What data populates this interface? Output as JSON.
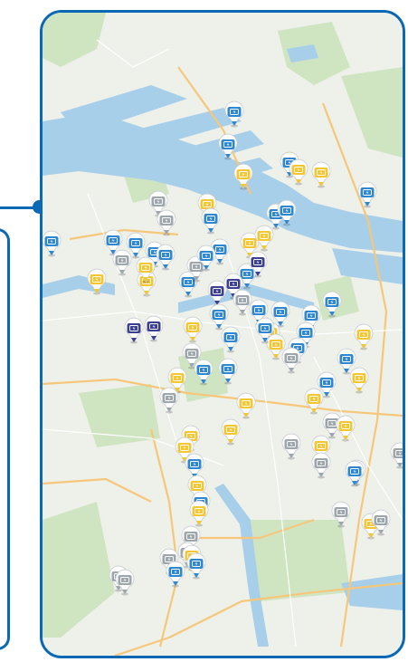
{
  "map": {
    "colors": {
      "frame": "#0a68b4",
      "water": "#a7cfe9",
      "land": "#eef0ea",
      "park": "#cfe5c2",
      "road_major": "#f6c77a",
      "pin_blue": "#2f86d1",
      "pin_yellow": "#f4c631",
      "pin_grey": "#9ea6ad",
      "pin_navy": "#3b3f91"
    },
    "pin_icon": "charging-station-icon",
    "pins": [
      {
        "type": "blue"
      },
      {
        "type": "blue"
      },
      {
        "type": "yellow"
      },
      {
        "type": "blue"
      },
      {
        "type": "yellow"
      },
      {
        "type": "yellow"
      },
      {
        "type": "blue"
      },
      {
        "type": "yellow"
      },
      {
        "type": "blue"
      },
      {
        "type": "blue"
      },
      {
        "type": "grey"
      },
      {
        "type": "yellow"
      },
      {
        "type": "blue"
      },
      {
        "type": "grey"
      },
      {
        "type": "blue"
      },
      {
        "type": "blue"
      },
      {
        "type": "blue"
      },
      {
        "type": "blue"
      },
      {
        "type": "grey"
      },
      {
        "type": "yellow"
      },
      {
        "type": "blue"
      },
      {
        "type": "yellow"
      },
      {
        "type": "grey"
      },
      {
        "type": "blue"
      },
      {
        "type": "blue"
      },
      {
        "type": "yellow"
      },
      {
        "type": "blue"
      },
      {
        "type": "navy"
      },
      {
        "type": "yellow"
      },
      {
        "type": "navy"
      },
      {
        "type": "navy"
      },
      {
        "type": "blue"
      },
      {
        "type": "grey"
      },
      {
        "type": "blue"
      },
      {
        "type": "blue"
      },
      {
        "type": "blue"
      },
      {
        "type": "blue"
      },
      {
        "type": "blue"
      },
      {
        "type": "yellow"
      },
      {
        "type": "yellow"
      },
      {
        "type": "yellow"
      },
      {
        "type": "navy"
      },
      {
        "type": "navy"
      },
      {
        "type": "blue"
      },
      {
        "type": "grey"
      },
      {
        "type": "blue"
      },
      {
        "type": "blue"
      },
      {
        "type": "blue"
      },
      {
        "type": "blue"
      },
      {
        "type": "yellow"
      },
      {
        "type": "blue"
      },
      {
        "type": "yellow"
      },
      {
        "type": "grey"
      },
      {
        "type": "blue"
      },
      {
        "type": "yellow"
      },
      {
        "type": "grey"
      },
      {
        "type": "blue"
      },
      {
        "type": "yellow"
      },
      {
        "type": "yellow"
      },
      {
        "type": "grey"
      },
      {
        "type": "yellow"
      },
      {
        "type": "yellow"
      },
      {
        "type": "blue"
      },
      {
        "type": "yellow"
      },
      {
        "type": "grey"
      },
      {
        "type": "yellow"
      },
      {
        "type": "yellow"
      },
      {
        "type": "grey"
      },
      {
        "type": "blue"
      },
      {
        "type": "blue"
      },
      {
        "type": "grey"
      },
      {
        "type": "yellow"
      },
      {
        "type": "blue"
      },
      {
        "type": "yellow"
      },
      {
        "type": "grey"
      },
      {
        "type": "grey"
      },
      {
        "type": "yellow"
      },
      {
        "type": "grey"
      },
      {
        "type": "blue"
      },
      {
        "type": "blue"
      },
      {
        "type": "grey"
      },
      {
        "type": "grey"
      },
      {
        "type": "yellow"
      },
      {
        "type": "grey"
      },
      {
        "type": "grey"
      }
    ]
  }
}
